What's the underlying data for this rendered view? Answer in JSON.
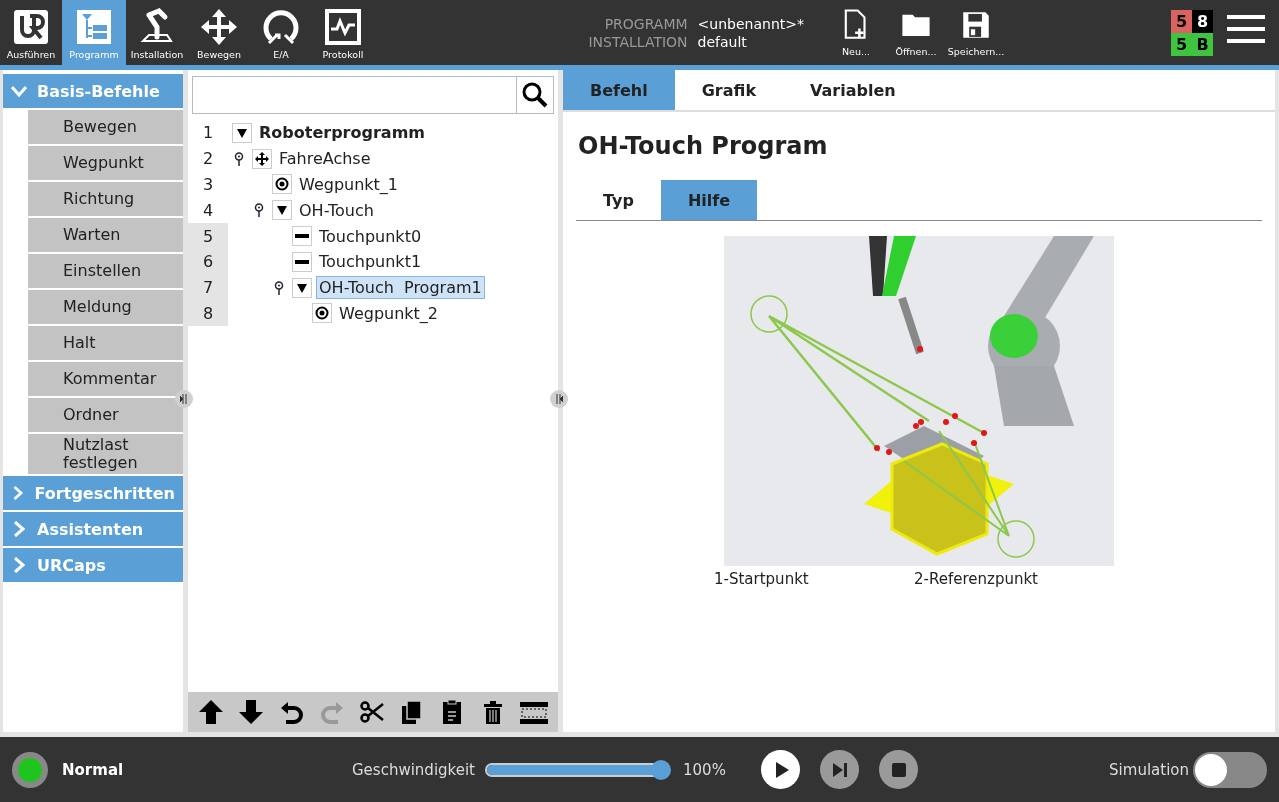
{
  "nav": [
    {
      "label": "Ausführen",
      "selected": false
    },
    {
      "label": "Programm",
      "selected": true
    },
    {
      "label": "Installation",
      "selected": false
    },
    {
      "label": "Bewegen",
      "selected": false
    },
    {
      "label": "E/A",
      "selected": false
    },
    {
      "label": "Protokoll",
      "selected": false
    }
  ],
  "file_info": {
    "program_label": "PROGRAMM",
    "program_value": "<unbenannt>*",
    "installation_label": "INSTALLATION",
    "installation_value": "default"
  },
  "file_buttons": [
    "Neu...",
    "Öffnen...",
    "Speichern..."
  ],
  "status_grid": [
    {
      "text": "5",
      "color": "#d9635f"
    },
    {
      "text": "8",
      "color": "#000000"
    },
    {
      "text": "5",
      "color": "#3ec43e"
    },
    {
      "text": "B",
      "color": "#3ec43e"
    }
  ],
  "sidebar": [
    {
      "label": "Basis-Befehle",
      "expanded": true,
      "items": [
        "Bewegen",
        "Wegpunkt",
        "Richtung",
        "Warten",
        "Einstellen",
        "Meldung",
        "Halt",
        "Kommentar",
        "Ordner",
        "Nutzlast festlegen"
      ]
    },
    {
      "label": "Fortgeschritten",
      "expanded": false
    },
    {
      "label": "Assistenten",
      "expanded": false
    },
    {
      "label": "URCaps",
      "expanded": false
    }
  ],
  "line_numbers": [
    {
      "text": "1",
      "highlighted": false
    },
    {
      "text": "2",
      "highlighted": false
    },
    {
      "text": "3",
      "highlighted": false
    },
    {
      "text": "4",
      "highlighted": false
    },
    {
      "text": "5",
      "highlighted": true
    },
    {
      "text": "6",
      "highlighted": true
    },
    {
      "text": "7",
      "highlighted": true
    },
    {
      "text": "8",
      "highlighted": true
    }
  ],
  "tree": [
    {
      "label": "Roboterprogramm",
      "kind": "root",
      "expanded": true,
      "selected": false,
      "children": [
        {
          "label": "FahreAchse",
          "kind": "move",
          "selected": false,
          "children": [
            {
              "label": "Wegpunkt_1",
              "kind": "waypoint",
              "selected": false
            },
            {
              "label": "OH-Touch",
              "kind": "group",
              "expanded": true,
              "selected": false,
              "children": [
                {
                  "label": "Touchpunkt0",
                  "kind": "touch",
                  "selected": false
                },
                {
                  "label": "Touchpunkt1",
                  "kind": "touch",
                  "selected": false
                },
                {
                  "label": "OH-Touch  Program1",
                  "kind": "group",
                  "expanded": true,
                  "selected": true,
                  "children": [
                    {
                      "label": "Wegpunkt_2",
                      "kind": "waypoint",
                      "selected": false
                    }
                  ]
                }
              ]
            }
          ]
        }
      ]
    }
  ],
  "tools": [
    {
      "disabled": false
    },
    {
      "disabled": false
    },
    {
      "disabled": false
    },
    {
      "disabled": true
    },
    {
      "disabled": false
    },
    {
      "disabled": false
    },
    {
      "disabled": false
    },
    {
      "disabled": false
    },
    {
      "disabled": false
    }
  ],
  "tabs": [
    {
      "label": "Befehl",
      "selected": true
    },
    {
      "label": "Grafik",
      "selected": false
    },
    {
      "label": "Variablen",
      "selected": false
    }
  ],
  "title": "OH-Touch Program",
  "subtabs": [
    {
      "label": "Typ",
      "selected": false
    },
    {
      "label": "Hilfe",
      "selected": true
    }
  ],
  "captions": [
    "1-Startpunkt",
    "2-Referenzpunkt"
  ],
  "footer": {
    "status": "Normal",
    "speed_label": "Geschwindigkeit",
    "speed": {
      "level": 1.0
    },
    "speed_reading": "100%",
    "controls": [
      {
        "disabled": false
      },
      {
        "disabled": true
      },
      {
        "disabled": true
      }
    ],
    "simulation_label": "Simulation",
    "simulation": {
      "on": false
    }
  }
}
